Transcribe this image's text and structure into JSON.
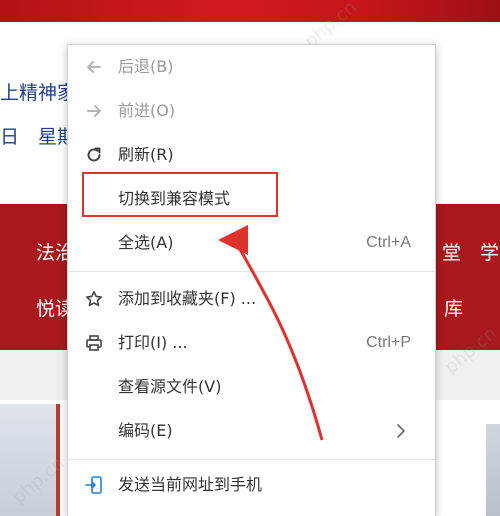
{
  "background_page": {
    "line1_text": "上精神家",
    "line2_date": "日",
    "line2_weekday": "星期",
    "band_left_top": "法治",
    "band_left_bottom": "悦读",
    "band_right_top_a": "堂",
    "band_right_top_b": "学",
    "band_right_bottom": "库"
  },
  "context_menu": {
    "items": [
      {
        "label": "后退(B)",
        "icon": "arrow-left-icon",
        "disabled": true,
        "shortcut": ""
      },
      {
        "label": "前进(O)",
        "icon": "arrow-right-icon",
        "disabled": true,
        "shortcut": ""
      },
      {
        "label": "刷新(R)",
        "icon": "refresh-icon",
        "disabled": false,
        "shortcut": ""
      },
      {
        "label": "切换到兼容模式",
        "icon": "",
        "disabled": false,
        "shortcut": ""
      },
      {
        "label": "全选(A)",
        "icon": "",
        "disabled": false,
        "shortcut": "Ctrl+A"
      },
      {
        "label": "添加到收藏夹(F) ...",
        "icon": "star-icon",
        "disabled": false,
        "shortcut": ""
      },
      {
        "label": "打印(I) ...",
        "icon": "printer-icon",
        "disabled": false,
        "shortcut": "Ctrl+P"
      },
      {
        "label": "查看源文件(V)",
        "icon": "",
        "disabled": false,
        "shortcut": ""
      },
      {
        "label": "编码(E)",
        "icon": "",
        "disabled": false,
        "shortcut": "",
        "submenu": true
      },
      {
        "label": "发送当前网址到手机",
        "icon": "send-to-phone-icon",
        "disabled": false,
        "shortcut": ""
      }
    ]
  },
  "annotation": {
    "highlight_color": "#e0322c",
    "arrow_color": "#e0322c"
  },
  "watermark_text": "php.cn"
}
